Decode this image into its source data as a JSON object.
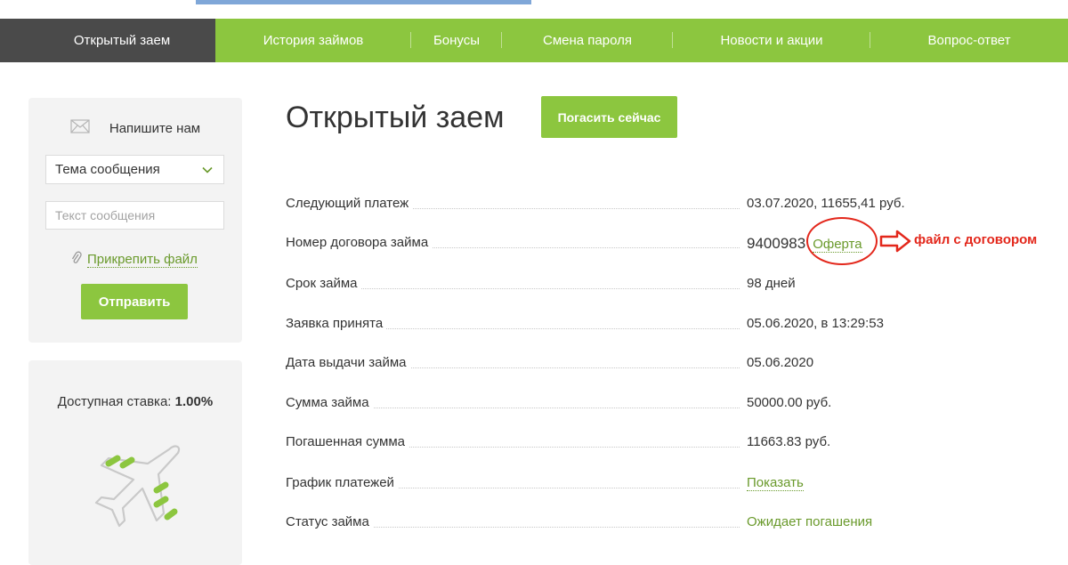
{
  "nav": {
    "items": [
      {
        "label": "Открытый заем"
      },
      {
        "label": "История займов"
      },
      {
        "label": "Бонусы"
      },
      {
        "label": "Смена пароля"
      },
      {
        "label": "Новости и акции"
      },
      {
        "label": "Вопрос-ответ"
      }
    ]
  },
  "contact": {
    "title": "Напишите нам",
    "topic_selected": "Тема сообщения",
    "message_placeholder": "Текст сообщения",
    "attach_label": "Прикрепить файл",
    "send_label": "Отправить"
  },
  "rate": {
    "label": "Доступная ставка:",
    "value": "1.00%"
  },
  "main": {
    "title": "Открытый заем",
    "pay_now_label": "Погасить сейчас",
    "rows": [
      {
        "label": "Следующий платеж",
        "value": "03.07.2020, 11655,41 руб."
      },
      {
        "label": "Номер договора займа",
        "value": "9400983",
        "link": "Оферта"
      },
      {
        "label": "Срок займа",
        "value": "98 дней"
      },
      {
        "label": "Заявка принята",
        "value": "05.06.2020, в 13:29:53"
      },
      {
        "label": "Дата выдачи займа",
        "value": "05.06.2020"
      },
      {
        "label": "Сумма займа",
        "value": "50000.00 руб."
      },
      {
        "label": "Погашенная сумма",
        "value": "11663.83 руб."
      },
      {
        "label": "График платежей",
        "value": "Показать"
      },
      {
        "label": "Статус займа",
        "value": "Ожидает погашения"
      }
    ]
  },
  "annotation": {
    "text": "файл с договором",
    "color": "#e3271b"
  },
  "colors": {
    "accent": "#8cc63f",
    "nav_active": "#4a4a4a",
    "link": "#6a9a2c"
  }
}
